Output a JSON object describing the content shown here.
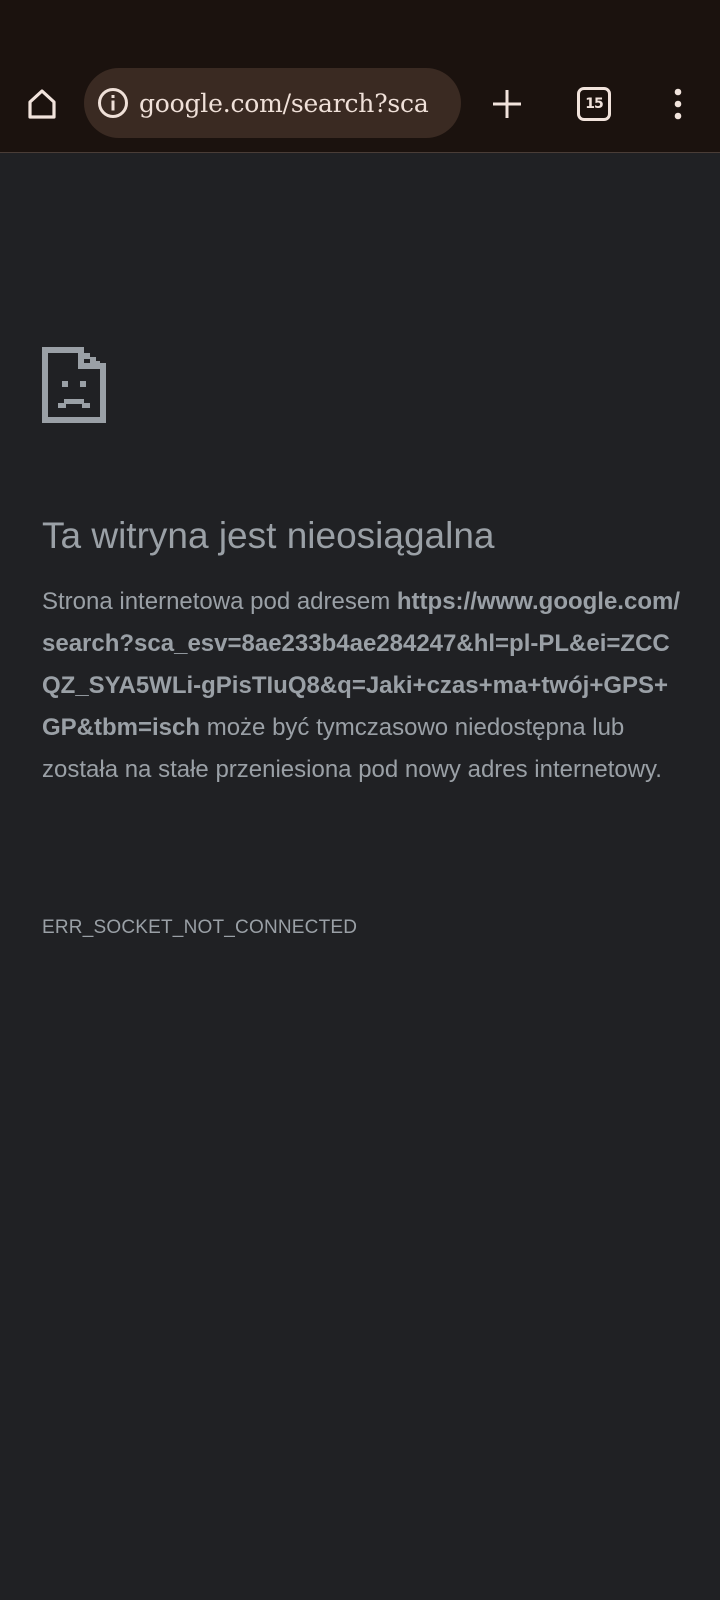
{
  "browser": {
    "address_bar": {
      "url": "google.com/search?sca"
    },
    "tab_count": "15",
    "icons": {
      "home": "home-icon",
      "site_info": "info-icon",
      "new_tab": "plus-icon",
      "tab_switcher": "tab-switcher-icon",
      "menu": "more-vert-icon"
    }
  },
  "error_page": {
    "icon": "sad-document-icon",
    "title": "Ta witryna jest nieosiągalna",
    "body_prefix": "Strona internetowa pod adresem ",
    "url": "https://www.google.com/search?sca_esv=8ae233b4ae284247&hl=pl-PL&ei=ZCCQZ_SYA5WLi-gPisTIuQ8&q=Jaki+czas+ma+twój+GPS+GP&tbm=isch",
    "body_suffix": " może być tymczasowo niedostępna lub została na stałe przeniesiona pod nowy adres internetowy.",
    "error_code": "ERR_SOCKET_NOT_CONNECTED"
  },
  "colors": {
    "toolbar_bg": "#1b120e",
    "omnibox_bg": "#3a2a22",
    "page_bg": "#202124",
    "text": "#9aa0a6"
  }
}
